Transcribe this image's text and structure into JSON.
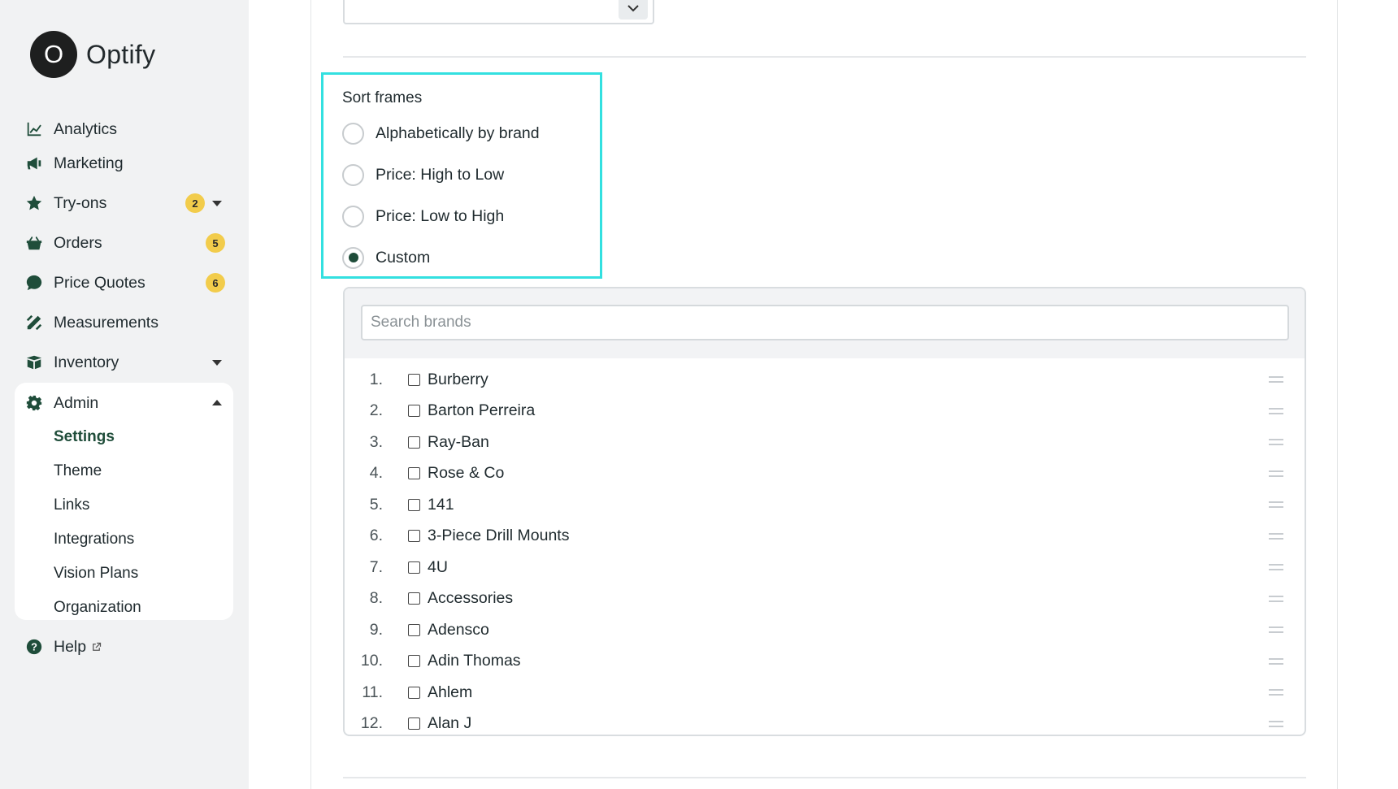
{
  "app": {
    "logo_letter": "O",
    "name": "Optify"
  },
  "sidebar": {
    "items": [
      {
        "label": "Analytics",
        "icon": "chart-line-icon"
      },
      {
        "label": "Marketing",
        "icon": "megaphone-icon"
      },
      {
        "label": "Try-ons",
        "icon": "star-icon",
        "badge": "2",
        "expandable": true
      },
      {
        "label": "Orders",
        "icon": "basket-icon",
        "badge": "5"
      },
      {
        "label": "Price Quotes",
        "icon": "dollar-bubble-icon",
        "badge": "6"
      },
      {
        "label": "Measurements",
        "icon": "ruler-pencil-icon"
      },
      {
        "label": "Inventory",
        "icon": "box-icon",
        "expandable": true
      },
      {
        "label": "Admin",
        "icon": "gear-icon",
        "expanded": true
      }
    ],
    "admin_sub": [
      "Settings",
      "Theme",
      "Links",
      "Integrations",
      "Vision Plans",
      "Organization"
    ],
    "admin_active": "Settings",
    "help": {
      "label": "Help",
      "icon": "question-circle-icon"
    }
  },
  "sort": {
    "title": "Sort frames",
    "options": [
      "Alphabetically by brand",
      "Price: High to Low",
      "Price: Low to High",
      "Custom"
    ],
    "selected": "Custom"
  },
  "brand_list": {
    "search_placeholder": "Search brands",
    "brands": [
      {
        "num": "1.",
        "name": "Burberry"
      },
      {
        "num": "2.",
        "name": "Barton Perreira"
      },
      {
        "num": "3.",
        "name": "Ray-Ban"
      },
      {
        "num": "4.",
        "name": "Rose & Co"
      },
      {
        "num": "5.",
        "name": "141"
      },
      {
        "num": "6.",
        "name": "3-Piece Drill Mounts"
      },
      {
        "num": "7.",
        "name": "4U"
      },
      {
        "num": "8.",
        "name": "Accessories"
      },
      {
        "num": "9.",
        "name": "Adensco"
      },
      {
        "num": "10.",
        "name": "Adin Thomas"
      },
      {
        "num": "11.",
        "name": "Ahlem"
      },
      {
        "num": "12.",
        "name": "Alan J"
      }
    ]
  },
  "colors": {
    "accent": "#1f4d3a",
    "badge": "#f2cc4b",
    "highlight": "#33e0e0",
    "sidebar_bg": "#f1f2f3"
  }
}
